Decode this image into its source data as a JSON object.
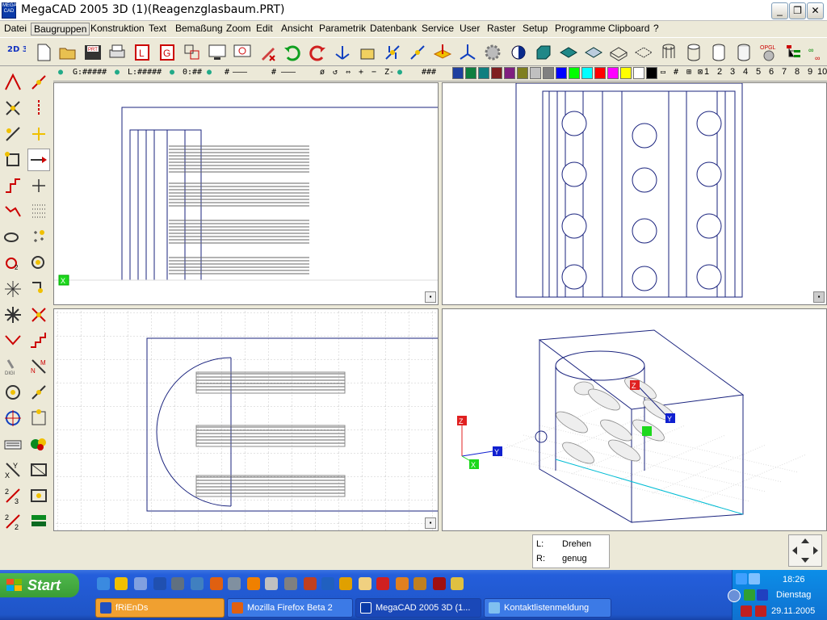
{
  "window": {
    "title": "MegaCAD 2005 3D (1)(Reagenzglasbaum.PRT)",
    "app_icon_text": "MEGA CAD"
  },
  "menu": [
    "Datei",
    "Baugruppen",
    "Konstruktion",
    "Text",
    "Bemaßung",
    "Zoom",
    "Edit",
    "Ansicht",
    "Parametrik",
    "Datenbank",
    "Service",
    "User",
    "Raster",
    "Setup",
    "Programme",
    "Clipboard",
    "?"
  ],
  "status_row": {
    "group": "G:#####",
    "layer": "L:#####",
    "pen": "0:##",
    "style": "#",
    "width": "#",
    "axes": "Z-",
    "hash3": "###",
    "numbers": [
      "1",
      "2",
      "3",
      "4",
      "5",
      "6",
      "7",
      "8",
      "9",
      "10"
    ]
  },
  "palette": [
    "#1f3f9f",
    "#0f7f3f",
    "#0f7f7f",
    "#7f1f1f",
    "#7f1f7f",
    "#7f7f1f",
    "#c0c0c0",
    "#808080",
    "#0000ff",
    "#00ff00",
    "#00ffff",
    "#ff0000",
    "#ff00ff",
    "#ffff00",
    "#ffffff",
    "#000000"
  ],
  "toolbar_labels": {
    "two_d_3d": "2D 3D",
    "prt": "PRT",
    "opgl": "OPGL"
  },
  "viewport_axes": {
    "x": "X",
    "y": "Y",
    "z": "Z"
  },
  "info": {
    "left_key": "L:",
    "left_val": "Drehen",
    "right_key": "R:",
    "right_val": "genug"
  },
  "taskbar": {
    "start": "Start",
    "tasks": [
      "fRiEnDs",
      "Mozilla Firefox Beta 2",
      "MegaCAD 2005 3D (1...",
      "Kontaktlistenmeldung"
    ],
    "clock": "18:26",
    "day": "Dienstag",
    "date": "29.11.2005"
  }
}
